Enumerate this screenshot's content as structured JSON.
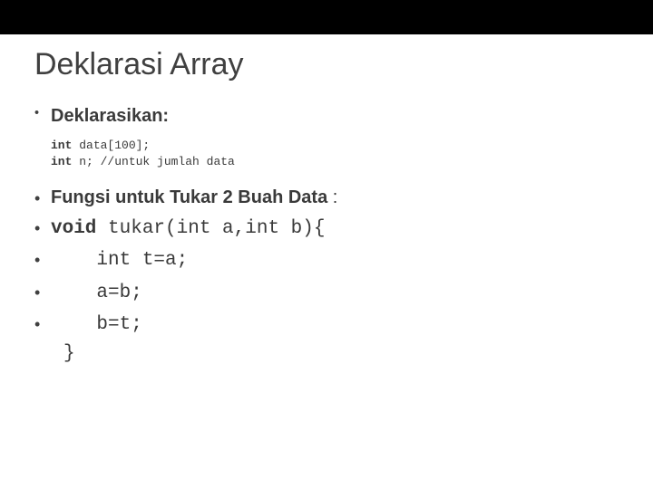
{
  "slide": {
    "title": "Deklarasi Array",
    "subhead1": "Deklarasikan:",
    "code_decl_line1_kw": "int ",
    "code_decl_line1_rest": "data[100];",
    "code_decl_line2_kw": "int ",
    "code_decl_line2_rest": "n; //untuk jumlah data",
    "subhead2": "Fungsi untuk Tukar 2 Buah Data ",
    "subhead2_colon": ":",
    "fn_line1_kw": "void ",
    "fn_line1_rest": "tukar(int a,int b){",
    "fn_line2": "    int t=a;",
    "fn_line3": "    a=b;",
    "fn_line4": "    b=t;",
    "fn_close": "}"
  }
}
